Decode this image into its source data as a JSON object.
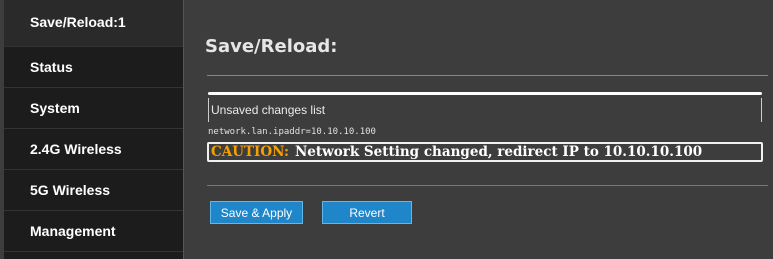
{
  "sidebar": {
    "items": [
      {
        "label": "Save/Reload:1",
        "active": true
      },
      {
        "label": "Status"
      },
      {
        "label": "System"
      },
      {
        "label": "2.4G Wireless"
      },
      {
        "label": "5G Wireless"
      },
      {
        "label": "Management"
      }
    ]
  },
  "main": {
    "title": "Save/Reload:",
    "unsaved_list_label": "Unsaved changes list",
    "changed_setting": "network.lan.ipaddr=10.10.10.100",
    "caution_tag": "CAUTION:",
    "caution_message": "Network Setting changed, redirect IP to  10.10.10.100",
    "save_apply_label": "Save & Apply",
    "revert_label": "Revert"
  },
  "colors": {
    "button_bg": "#1f86c9",
    "caution_tag": "#f5a000",
    "sidebar_bg": "#1c1c1c",
    "main_bg": "#3d3d3d"
  }
}
